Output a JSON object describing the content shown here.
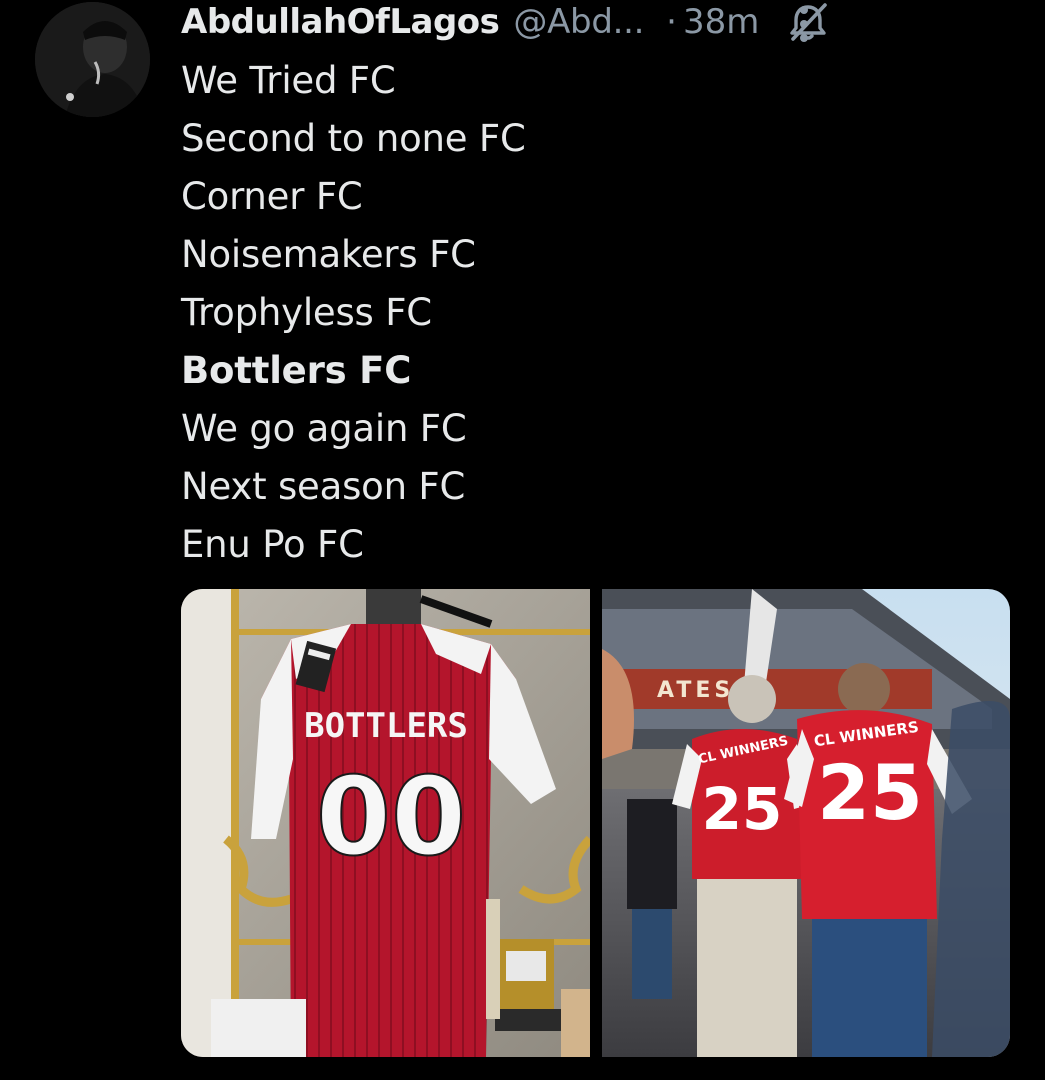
{
  "tweet": {
    "author": {
      "display_name": "AbdullahOfLagos",
      "handle": "@Abd...",
      "avatar_icon": "avatar"
    },
    "separator": "·",
    "timestamp": "38m",
    "mute_icon": "muted-bell-icon",
    "more_icon": "more-options-icon",
    "lines": [
      "We Tried FC",
      "Second to none FC",
      "Corner FC",
      "Noisemakers FC",
      "Trophyless FC",
      "Bottlers FC",
      "We go again FC",
      "Next season FC",
      "Enu Po FC"
    ],
    "bold_line_index": 5,
    "media": [
      {
        "name": "jersey-photo",
        "jersey_name": "BOTTLERS",
        "jersey_number": "00"
      },
      {
        "name": "stadium-fans-photo",
        "shirt_text": "CL WINNERS",
        "shirt_number": "25",
        "stadium_sign": "ATES"
      }
    ]
  },
  "colors": {
    "background": "#000000",
    "primary_text": "#e7e9ea",
    "secondary_text": "#8b98a5",
    "arsenal_red": "#c8102e"
  }
}
